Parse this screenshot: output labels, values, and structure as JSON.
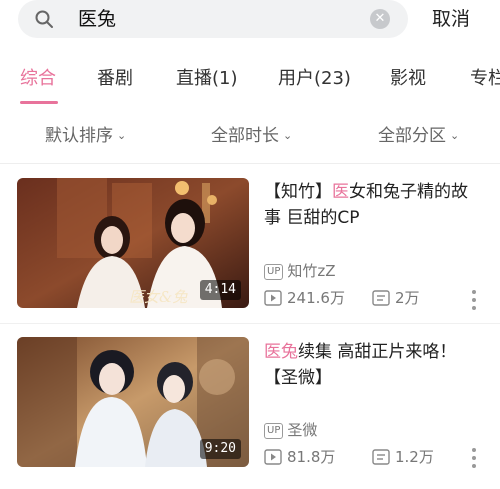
{
  "search": {
    "query": "医兔",
    "cancel_label": "取消"
  },
  "tabs": [
    {
      "label": "综合",
      "active": true
    },
    {
      "label": "番剧"
    },
    {
      "label": "直播(1)"
    },
    {
      "label": "用户(23)"
    },
    {
      "label": "影视"
    },
    {
      "label": "专栏"
    }
  ],
  "filters": [
    {
      "label": "默认排序"
    },
    {
      "label": "全部时长"
    },
    {
      "label": "全部分区"
    }
  ],
  "accent_color": "#e8739b",
  "videos": [
    {
      "title_pre": "【知竹】",
      "title_hl": "医",
      "title_post": "女和兔子精的故事 巨甜的CP",
      "duration": "4:14",
      "up_badge": "UP",
      "uploader": "知竹zZ",
      "views": "241.6万",
      "danmaku": "2万"
    },
    {
      "title_pre": "",
      "title_hl": "医兔",
      "title_post": "续集 高甜正片来咯！【圣微】",
      "duration": "9:20",
      "up_badge": "UP",
      "uploader": "圣微",
      "views": "81.8万",
      "danmaku": "1.2万"
    }
  ]
}
